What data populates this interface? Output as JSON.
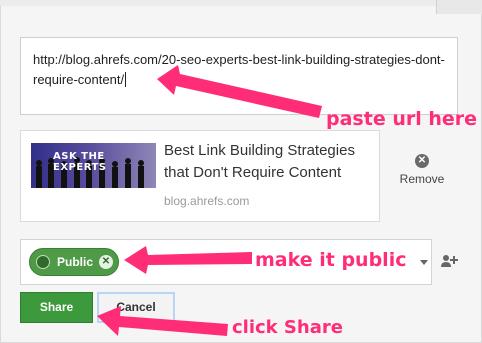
{
  "composer": {
    "url_text": "http://blog.ahrefs.com/20-seo-experts-best-link-building-strategies-dont-require-content/"
  },
  "preview": {
    "thumbnail_text": "ASK THE EXPERTS",
    "title": "Best Link Building Strategies that Don't Require Content",
    "domain": "blog.ahrefs.com",
    "remove_label": "Remove",
    "remove_icon": "close-circle-icon"
  },
  "audience": {
    "chip_label": "Public",
    "chip_icon": "globe-icon",
    "chip_close_icon": "close-circle-icon"
  },
  "actions": {
    "share_label": "Share",
    "cancel_label": "Cancel"
  },
  "annotations": {
    "paste": "paste url here",
    "public": "make it public",
    "share": "click Share",
    "color": "#ff2d78"
  },
  "colors": {
    "share_green": "#3d9a3c",
    "public_green": "#4f9a47",
    "cancel_focus": "#b9d5f6"
  }
}
